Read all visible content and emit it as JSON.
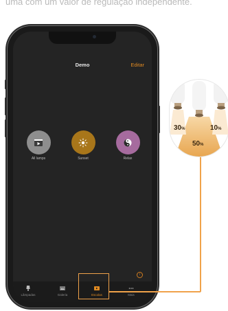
{
  "caption": {
    "text": "uma com um valor de regulação independente."
  },
  "app": {
    "title": "Demo",
    "edit_label": "Editar"
  },
  "scenes": [
    {
      "label": "All lamps",
      "icon": "play-icon",
      "color": "#8e8e8e"
    },
    {
      "label": "Sunset",
      "icon": "sun-icon",
      "color": "#a8761a"
    },
    {
      "label": "Relax",
      "icon": "yin-yang-icon",
      "color": "#a66b9e"
    }
  ],
  "tabs": [
    {
      "label": "Lâmpadas",
      "icon": "lamp-icon",
      "active": false
    },
    {
      "label": "Galeria",
      "icon": "gallery-icon",
      "active": false
    },
    {
      "label": "Escolas",
      "icon": "scenes-icon",
      "active": true
    },
    {
      "label": "Mais",
      "icon": "more-icon",
      "active": false
    }
  ],
  "dimming": {
    "left": "30",
    "right": "10",
    "bottom": "50",
    "unit": "%"
  },
  "colors": {
    "accent": "#e08a22",
    "callout": "#f0a24a",
    "background": "#242424"
  }
}
